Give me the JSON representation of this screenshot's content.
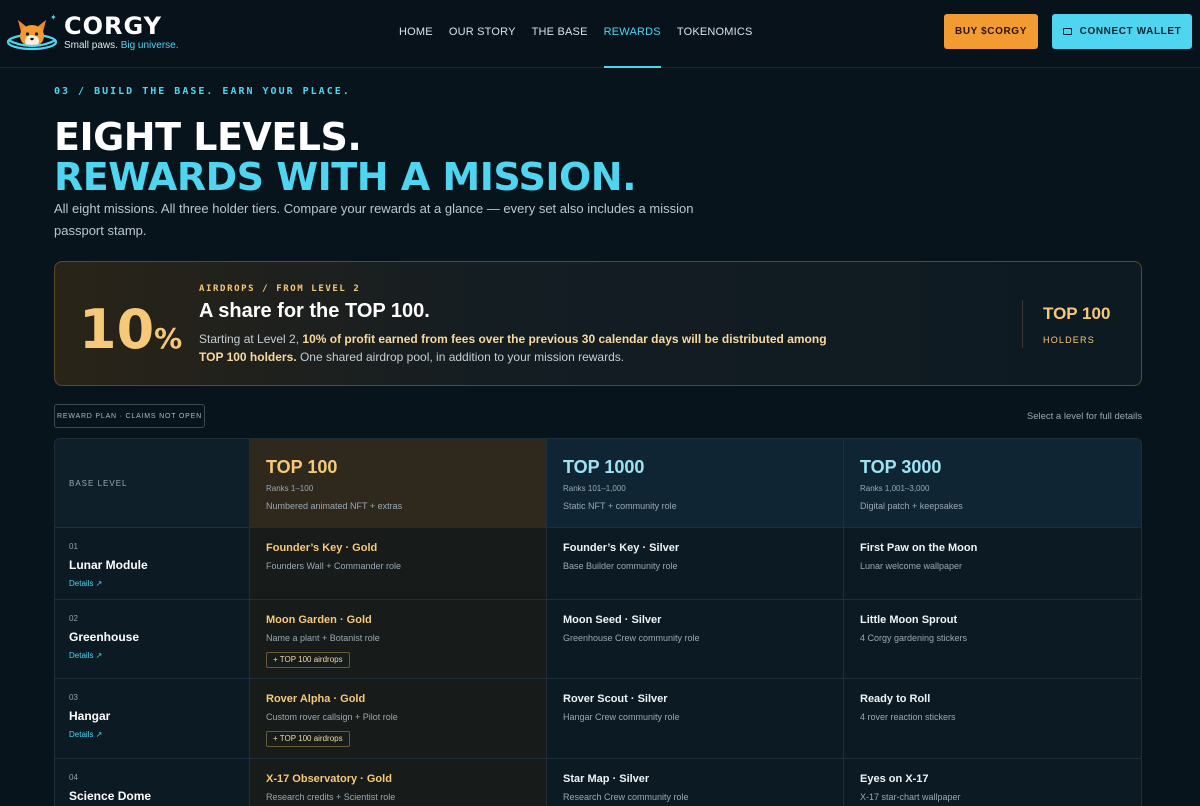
{
  "nav": {
    "brand": "CORGY",
    "tagline_a": "Small paws.",
    "tagline_b": "Big universe.",
    "links": [
      "HOME",
      "OUR STORY",
      "THE BASE",
      "REWARDS",
      "TOKENOMICS"
    ],
    "active": "REWARDS",
    "buy": "BUY $CORGY",
    "wallet": "CONNECT WALLET"
  },
  "hero": {
    "eyebrow": "03 / BUILD THE BASE. EARN YOUR PLACE.",
    "line1": "EIGHT LEVELS.",
    "line2": "REWARDS WITH A MISSION.",
    "lede": "All eight missions. All three holder tiers. Compare your rewards at a glance — every set also includes a mission passport stamp."
  },
  "airdrop": {
    "percent": "10",
    "percent_sym": "%",
    "eyebrow": "AIRDROPS / FROM LEVEL 2",
    "title": "A share for the TOP 100.",
    "body_a": "Starting at Level 2, ",
    "body_b": "10% of profit earned from fees over the previous 30 calendar days will be distributed among TOP 100 holders.",
    "body_c": " One shared airdrop pool, in addition to your mission rewards.",
    "side_title": "TOP 100",
    "side_label": "HOLDERS"
  },
  "plan_pill": "REWARD PLAN · CLAIMS NOT OPEN",
  "select_note": "Select a level for full details",
  "table": {
    "base_header": "BASE LEVEL",
    "tiers": [
      {
        "title": "TOP 100",
        "ranks": "Ranks 1–100",
        "sub": "Numbered animated NFT + extras"
      },
      {
        "title": "TOP 1000",
        "ranks": "Ranks 101–1,000",
        "sub": "Static NFT + community role"
      },
      {
        "title": "TOP 3000",
        "ranks": "Ranks 1,001–3,000",
        "sub": "Digital patch + keepsakes"
      }
    ],
    "details_label": "Details ↗",
    "rows": [
      {
        "num": "01",
        "name": "Lunar Module",
        "c1": {
          "t": "Founder’s Key · Gold",
          "d": "Founders Wall + Commander role",
          "tag": ""
        },
        "c2": {
          "t": "Founder’s Key · Silver",
          "d": "Base Builder community role"
        },
        "c3": {
          "t": "First Paw on the Moon",
          "d": "Lunar welcome wallpaper"
        }
      },
      {
        "num": "02",
        "name": "Greenhouse",
        "c1": {
          "t": "Moon Garden · Gold",
          "d": "Name a plant + Botanist role",
          "tag": "+ TOP 100 airdrops"
        },
        "c2": {
          "t": "Moon Seed · Silver",
          "d": "Greenhouse Crew community role"
        },
        "c3": {
          "t": "Little Moon Sprout",
          "d": "4 Corgy gardening stickers"
        }
      },
      {
        "num": "03",
        "name": "Hangar",
        "c1": {
          "t": "Rover Alpha · Gold",
          "d": "Custom rover callsign + Pilot role",
          "tag": "+ TOP 100 airdrops"
        },
        "c2": {
          "t": "Rover Scout · Silver",
          "d": "Hangar Crew community role"
        },
        "c3": {
          "t": "Ready to Roll",
          "d": "4 rover reaction stickers"
        }
      },
      {
        "num": "04",
        "name": "Science Dome",
        "c1": {
          "t": "X-17 Observatory · Gold",
          "d": "Research credits + Scientist role",
          "tag": ""
        },
        "c2": {
          "t": "Star Map · Silver",
          "d": "Research Crew community role"
        },
        "c3": {
          "t": "Eyes on X-17",
          "d": "X-17 star-chart wallpaper"
        }
      }
    ]
  }
}
